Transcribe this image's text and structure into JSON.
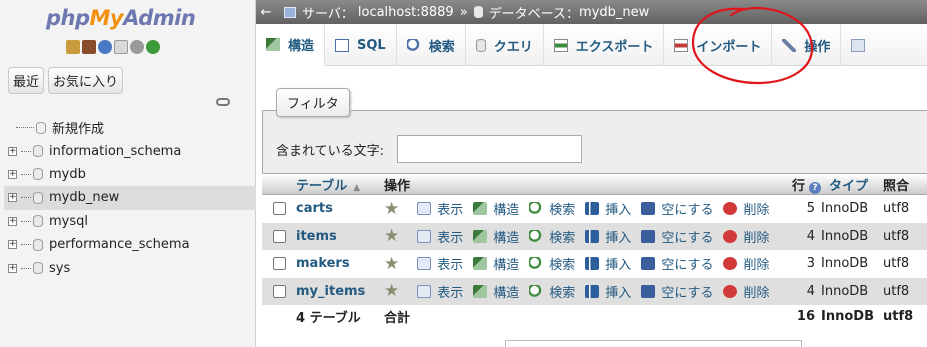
{
  "logo": {
    "php": "php",
    "my": "My",
    "admin": "Admin"
  },
  "sidebar": {
    "recent_btn": "最近",
    "favorites_btn": "お気に入り",
    "new_item": "新規作成",
    "databases": [
      {
        "label": "information_schema"
      },
      {
        "label": "mydb"
      },
      {
        "label": "mydb_new"
      },
      {
        "label": "mysql"
      },
      {
        "label": "performance_schema"
      },
      {
        "label": "sys"
      }
    ]
  },
  "breadcrumb": {
    "server_label": "サーバ：",
    "server_value": "localhost:8889",
    "separator": "»",
    "db_label": "データベース：",
    "db_value": "mydb_new"
  },
  "tabs": [
    {
      "label": "構造",
      "icon": "structure-icon"
    },
    {
      "label": "SQL",
      "icon": "sql-icon"
    },
    {
      "label": "検索",
      "icon": "search-icon"
    },
    {
      "label": "クエリ",
      "icon": "query-icon"
    },
    {
      "label": "エクスポート",
      "icon": "export-icon"
    },
    {
      "label": "インポート",
      "icon": "import-icon"
    },
    {
      "label": "操作",
      "icon": "wrench-icon"
    }
  ],
  "filter": {
    "legend": "フィルタ",
    "label": "含まれている文字:",
    "value": ""
  },
  "table": {
    "headers": {
      "table": "テーブル",
      "action": "操作",
      "rows": "行",
      "type": "タイプ",
      "collation": "照合"
    },
    "action_labels": {
      "browse": "表示",
      "structure": "構造",
      "search": "検索",
      "insert": "挿入",
      "empty": "空にする",
      "drop": "削除"
    },
    "rows": [
      {
        "name": "carts",
        "rows": "5",
        "type": "InnoDB",
        "collation": "utf8"
      },
      {
        "name": "items",
        "rows": "4",
        "type": "InnoDB",
        "collation": "utf8"
      },
      {
        "name": "makers",
        "rows": "3",
        "type": "InnoDB",
        "collation": "utf8"
      },
      {
        "name": "my_items",
        "rows": "4",
        "type": "InnoDB",
        "collation": "utf8"
      }
    ],
    "footer": {
      "count": "4 テーブル",
      "sum": "合計",
      "rows": "16",
      "type": "InnoDB",
      "collation": "utf8"
    }
  },
  "colors": {
    "link": "#235a81",
    "topbar": "#6f6f6f",
    "annotation": "#e0141b"
  }
}
